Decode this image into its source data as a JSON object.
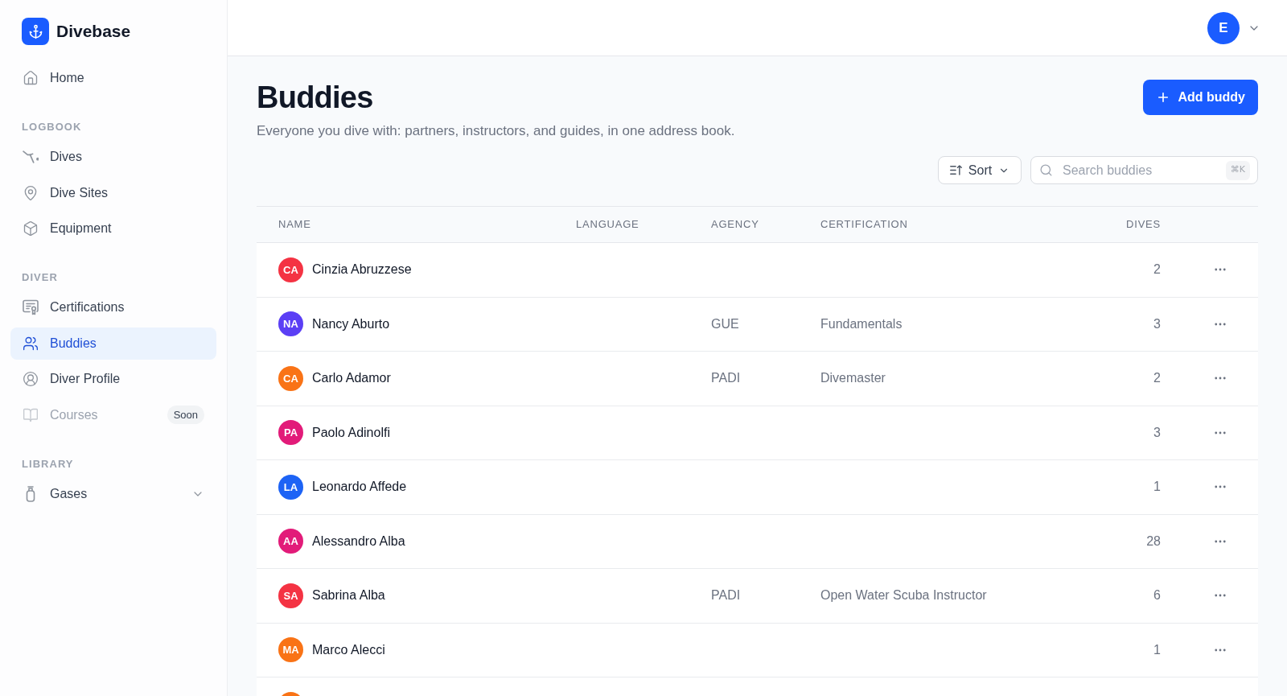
{
  "brand": {
    "name": "Divebase"
  },
  "sidebar": {
    "sections": [
      {
        "items": [
          {
            "label": "Home",
            "selected": false,
            "disabled": false
          }
        ]
      },
      {
        "heading": "LOGBOOK",
        "items": [
          {
            "label": "Dives",
            "selected": false,
            "disabled": false
          },
          {
            "label": "Dive Sites",
            "selected": false,
            "disabled": false
          },
          {
            "label": "Equipment",
            "selected": false,
            "disabled": false
          }
        ]
      },
      {
        "heading": "DIVER",
        "items": [
          {
            "label": "Certifications",
            "selected": false,
            "disabled": false
          },
          {
            "label": "Buddies",
            "selected": true,
            "disabled": false
          },
          {
            "label": "Diver Profile",
            "selected": false,
            "disabled": false
          },
          {
            "label": "Courses",
            "selected": false,
            "disabled": true,
            "badge": "Soon"
          }
        ]
      },
      {
        "heading": "LIBRARY",
        "items": [
          {
            "label": "Gases",
            "selected": false,
            "disabled": false,
            "expanded": false
          }
        ]
      }
    ]
  },
  "topbar": {
    "account": {
      "initial": "E"
    }
  },
  "page": {
    "title": "Buddies",
    "subtitle": "Everyone you dive with: partners, instructors, and guides, in one address book.",
    "add_button": {
      "label": "Add buddy"
    },
    "sort_button": {
      "label": "Sort"
    },
    "search": {
      "placeholder": "Search buddies",
      "shortcut": "⌘K"
    }
  },
  "table": {
    "columns": [
      "NAME",
      "LANGUAGE",
      "AGENCY",
      "CERTIFICATION",
      "DIVES"
    ],
    "rows": [
      {
        "initials": "CA",
        "color": "#f43343",
        "name": "Cinzia Abruzzese",
        "dives": "2"
      },
      {
        "initials": "NA",
        "color": "#5b3ff5",
        "name": "Nancy Aburto",
        "agency": "GUE",
        "certification": "Fundamentals",
        "dives": "3"
      },
      {
        "initials": "CA",
        "color": "#f97316",
        "name": "Carlo Adamor",
        "agency": "PADI",
        "certification": "Divemaster",
        "dives": "2"
      },
      {
        "initials": "PA",
        "color": "#e21b79",
        "name": "Paolo Adinolfi",
        "dives": "3"
      },
      {
        "initials": "LA",
        "color": "#1d63f5",
        "name": "Leonardo Affede",
        "dives": "1"
      },
      {
        "initials": "AA",
        "color": "#e21b79",
        "name": "Alessandro Alba",
        "dives": "28"
      },
      {
        "initials": "SA",
        "color": "#f43343",
        "name": "Sabrina Alba",
        "agency": "PADI",
        "certification": "Open Water Scuba Instructor",
        "dives": "6"
      },
      {
        "initials": "MA",
        "color": "#f97316",
        "name": "Marco Alecci",
        "dives": "1"
      },
      {
        "color": "#f97316"
      }
    ]
  }
}
